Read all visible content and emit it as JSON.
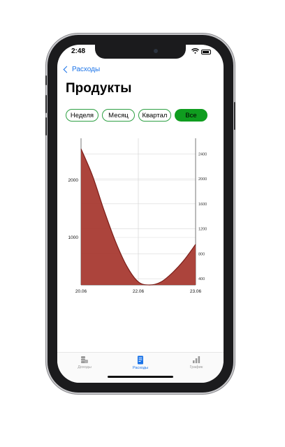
{
  "status_bar": {
    "time": "2:48"
  },
  "nav": {
    "back_label": "Расходы"
  },
  "page": {
    "title": "Продукты"
  },
  "segments": [
    {
      "label": "Неделя",
      "active": false
    },
    {
      "label": "Месяц",
      "active": false
    },
    {
      "label": "Квартал",
      "active": false
    },
    {
      "label": "Все",
      "active": true
    }
  ],
  "tabbar": {
    "items": [
      {
        "label": "Доходы",
        "icon": "coins-icon",
        "active": false
      },
      {
        "label": "Расходы",
        "icon": "receipt-icon",
        "active": true
      },
      {
        "label": "График",
        "icon": "bar-chart-icon",
        "active": false
      }
    ]
  },
  "colors": {
    "accent": "#1a73e8",
    "segment_active": "#0f9d1f",
    "segment_border": "#2ea043",
    "area_fill": "#a83a32",
    "area_line": "#7a1d18"
  },
  "chart_data": {
    "type": "area",
    "x_ticks": [
      "20.06",
      "22.06",
      "23.06"
    ],
    "left_axis": {
      "ticks": [
        "2000",
        "1000"
      ]
    },
    "right_axis": {
      "ticks": [
        "2400",
        "2000",
        "1600",
        "1200",
        "800",
        "400"
      ]
    },
    "grid": true,
    "series": [
      {
        "points": [
          [
            0,
            2480
          ],
          [
            0.1,
            2050
          ],
          [
            0.2,
            1500
          ],
          [
            0.3,
            1000
          ],
          [
            0.4,
            600
          ],
          [
            0.5,
            350
          ],
          [
            0.6,
            300
          ],
          [
            0.7,
            350
          ],
          [
            0.8,
            500
          ],
          [
            0.9,
            700
          ],
          [
            1,
            950
          ]
        ]
      }
    ]
  }
}
